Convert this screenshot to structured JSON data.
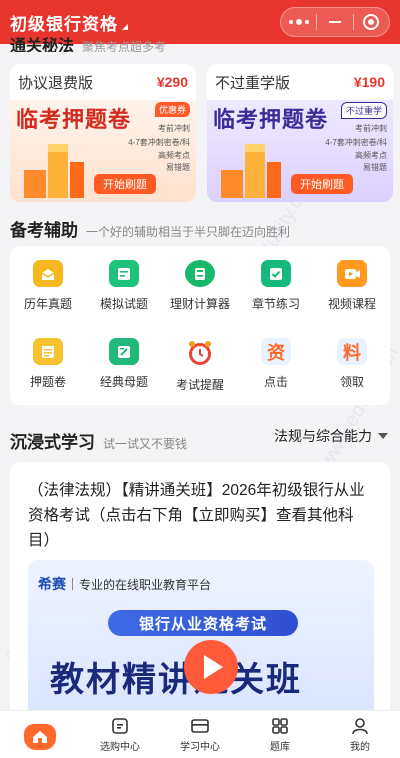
{
  "header": {
    "title": "初级银行资格"
  },
  "cut_section": {
    "title": "通关秘法",
    "subtitle": "聚焦考点超多考"
  },
  "products": [
    {
      "name": "协议退费版",
      "price": "¥290",
      "banner_title": "临考押题卷",
      "tag": "优惠券",
      "lines": [
        "考前冲刺",
        "4-7套冲刺密卷/科",
        "高频考点",
        "易错题"
      ],
      "button": "开始刷题",
      "theme": "orange"
    },
    {
      "name": "不过重学版",
      "price": "¥190",
      "banner_title": "临考押题卷",
      "tag": "不过重学",
      "lines": [
        "考前冲刺",
        "4-7套冲刺密卷/科",
        "高频考点",
        "易错题"
      ],
      "button": "开始刷题",
      "theme": "purple"
    }
  ],
  "assist": {
    "title": "备考辅助",
    "subtitle": "一个好的辅助相当于半只脚在迈向胜利"
  },
  "tools": [
    {
      "label": "历年真题",
      "icon": "past-papers-icon",
      "color": "#f6b820"
    },
    {
      "label": "模拟试题",
      "icon": "mock-test-icon",
      "color": "#1fc27a"
    },
    {
      "label": "理财计算器",
      "icon": "calculator-icon",
      "color": "#19b86a"
    },
    {
      "label": "章节练习",
      "icon": "chapter-practice-icon",
      "color": "#16b97c"
    },
    {
      "label": "视频课程",
      "icon": "video-course-icon",
      "color": "#ff9a1f"
    },
    {
      "label": "押题卷",
      "icon": "prediction-paper-icon",
      "color": "#f7c230"
    },
    {
      "label": "经典母题",
      "icon": "classic-questions-icon",
      "color": "#21b97a"
    },
    {
      "label": "考试提醒",
      "icon": "alarm-clock-icon",
      "color": "#e8442f"
    },
    {
      "label": "点击",
      "icon": "zi-character-icon",
      "glyph": "资",
      "color": "#ff6a2a"
    },
    {
      "label": "领取",
      "icon": "liao-character-icon",
      "glyph": "料",
      "color": "#ff6a2a"
    }
  ],
  "immersive": {
    "title": "沉浸式学习",
    "subtitle": "试一试又不要钱",
    "filter": "法规与综合能力"
  },
  "course": {
    "description": "（法律法规）【精讲通关班】2026年初级银行从业资格考试（点击右下角【立即购买】查看其他科目）",
    "video": {
      "brand": "希赛",
      "slogan": "专业的在线职业教育平台",
      "subtitle": "银行从业资格考试",
      "title": "教材精讲通关班"
    }
  },
  "tabbar": [
    {
      "label": "",
      "icon": "home-icon",
      "active": true
    },
    {
      "label": "选购中心",
      "icon": "shop-icon"
    },
    {
      "label": "学习中心",
      "icon": "study-icon"
    },
    {
      "label": "题库",
      "icon": "question-bank-icon"
    },
    {
      "label": "我的",
      "icon": "profile-icon"
    }
  ],
  "watermark": "希赛网 www.educity.cn"
}
